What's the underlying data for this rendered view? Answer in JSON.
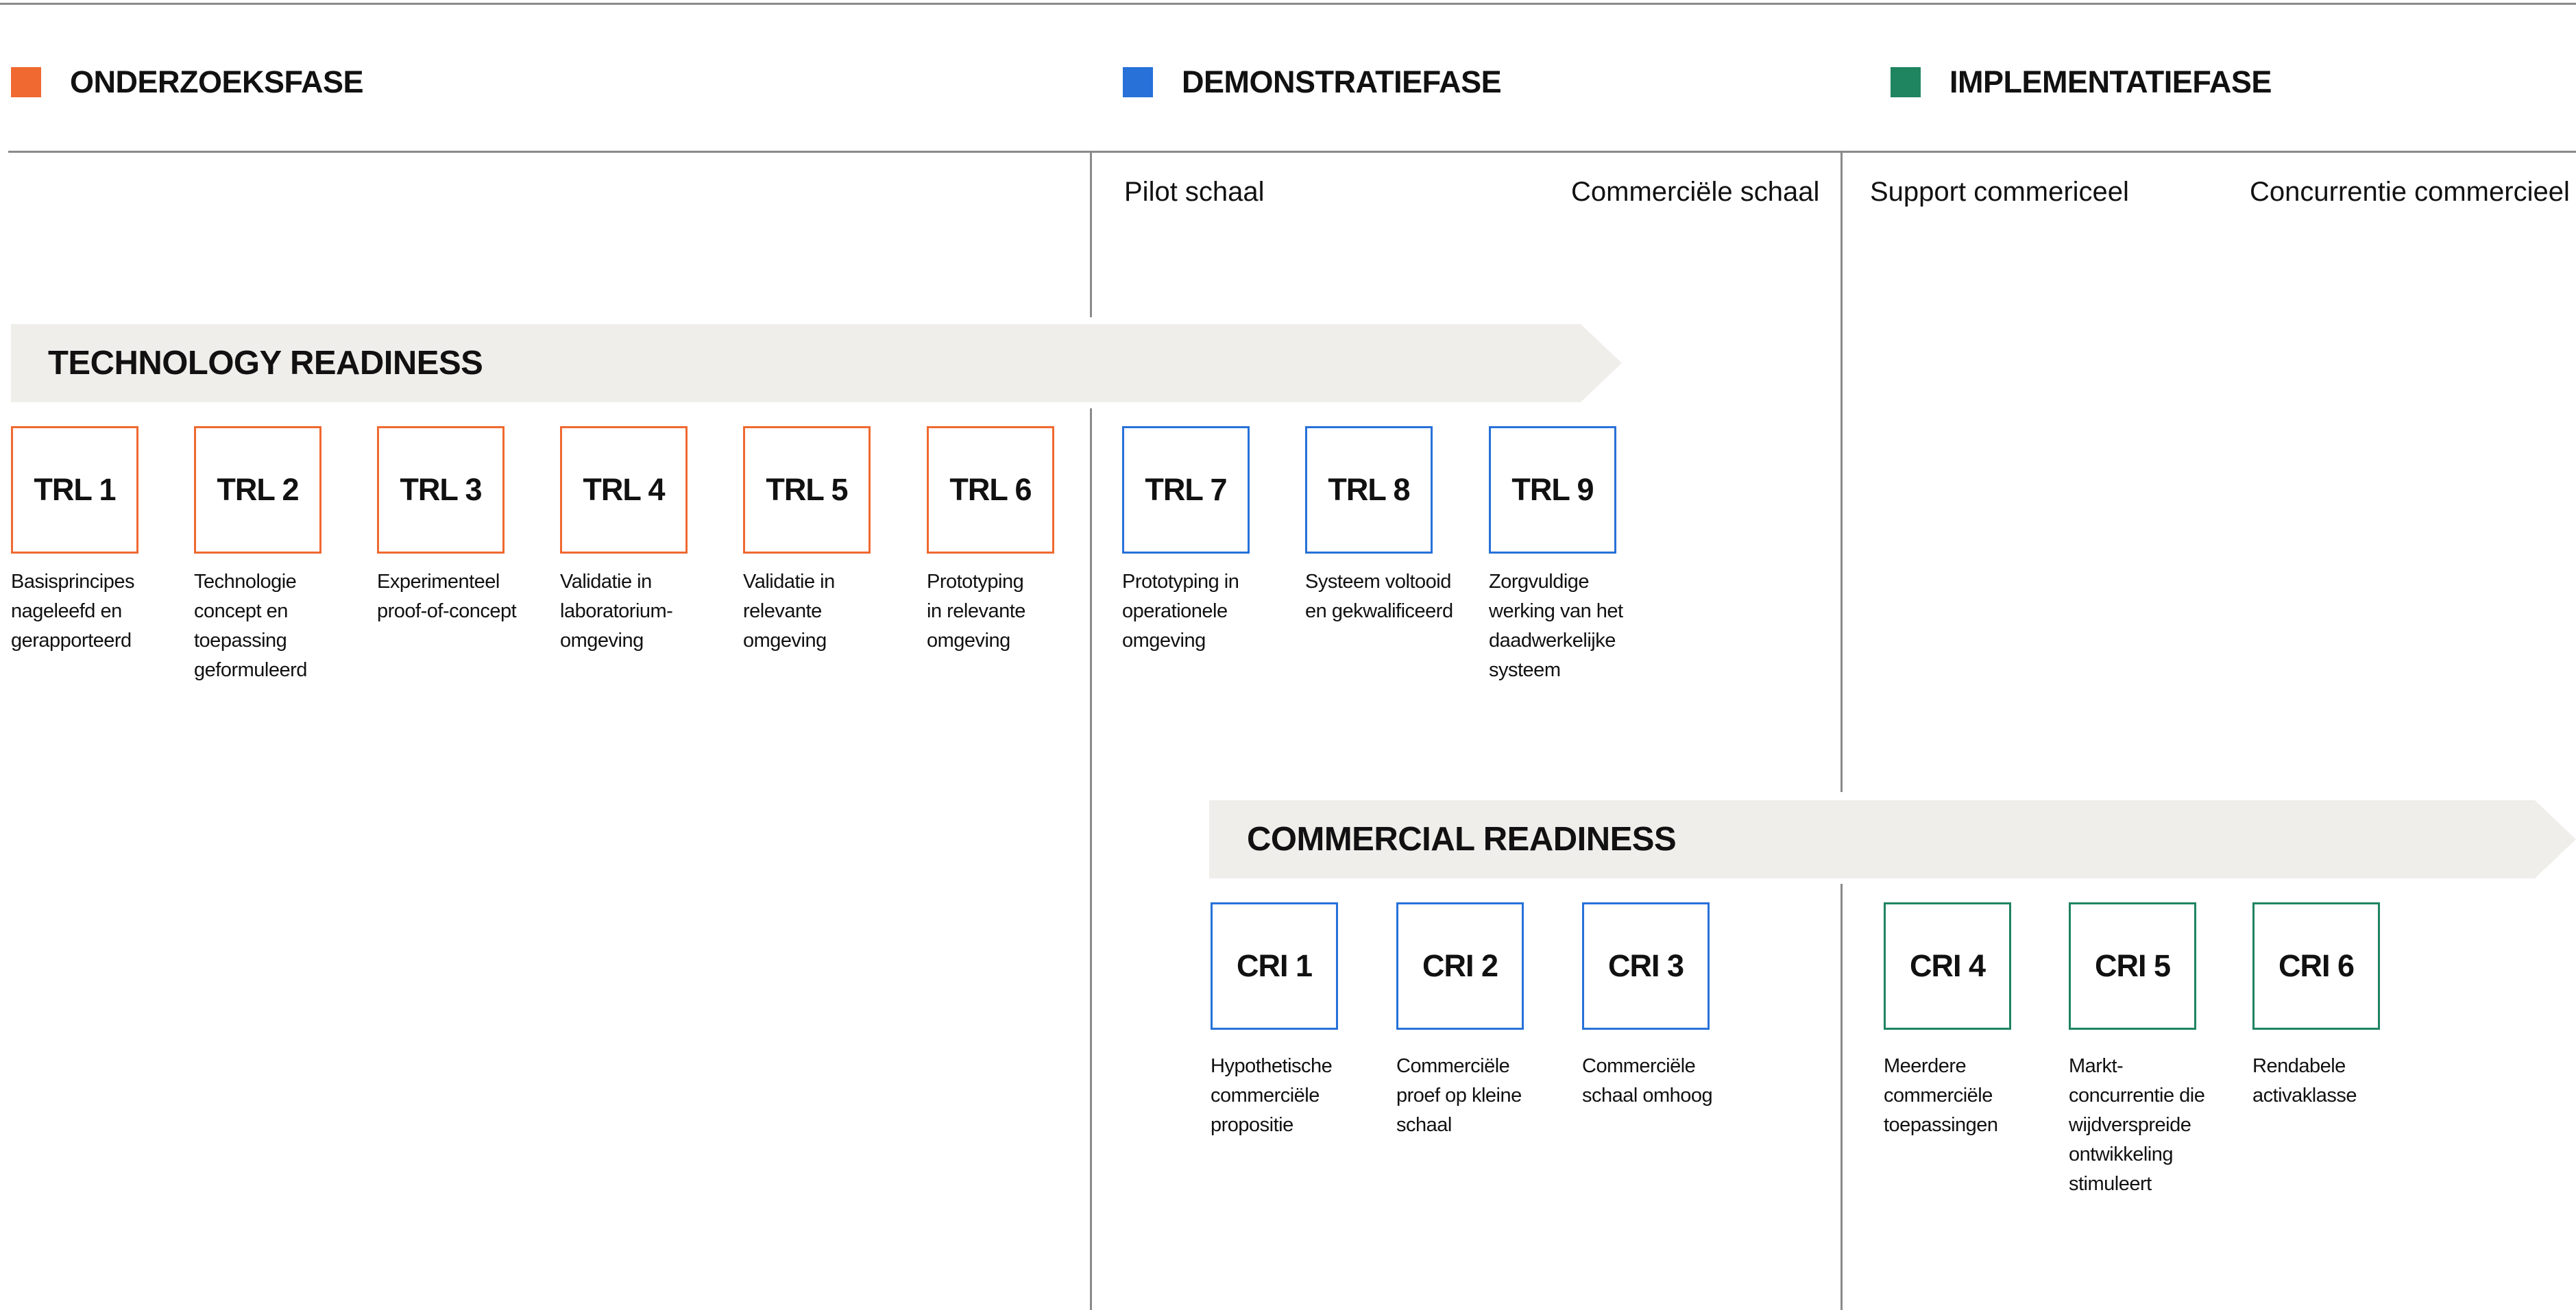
{
  "colors": {
    "onderzoek": "#ef6930",
    "demonstratie": "#2771d8",
    "implementatie": "#1f8460",
    "banner": "#f0eeeb",
    "line": "#8a8a8a"
  },
  "phases": [
    {
      "label": "ONDERZOEKSFASE"
    },
    {
      "label": "DEMONSTRATIEFASE"
    },
    {
      "label": "IMPLEMENTATIEFASE"
    }
  ],
  "scales": [
    {
      "label": "Pilot schaal"
    },
    {
      "label": "Commerciële schaal"
    },
    {
      "label": "Support commericeel"
    },
    {
      "label": "Concurrentie commercieel"
    }
  ],
  "technology": {
    "title": "TECHNOLOGY READINESS",
    "levels": [
      {
        "label": "TRL 1",
        "desc": "Basisprincipes nageleefd en gerapporteerd"
      },
      {
        "label": "TRL 2",
        "desc": "Technologie concept en toepassing geformuleerd"
      },
      {
        "label": "TRL 3",
        "desc": "Experimenteel proof-of-concept"
      },
      {
        "label": "TRL 4",
        "desc": "Validatie in laboratorium-omgeving"
      },
      {
        "label": "TRL 5",
        "desc": "Validatie in relevante omgeving"
      },
      {
        "label": "TRL 6",
        "desc": "Prototyping in relevante omgeving"
      },
      {
        "label": "TRL 7",
        "desc": "Prototyping in operationele omgeving"
      },
      {
        "label": "TRL 8",
        "desc": "Systeem voltooid en gekwalificeerd"
      },
      {
        "label": "TRL 9",
        "desc": "Zorgvuldige werking van het daadwerkelijke systeem"
      }
    ]
  },
  "commercial": {
    "title": "COMMERCIAL READINESS",
    "levels": [
      {
        "label": "CRI 1",
        "desc": "Hypothetische commerciële propositie"
      },
      {
        "label": "CRI 2",
        "desc": "Commerciële proef op kleine schaal"
      },
      {
        "label": "CRI 3",
        "desc": "Commerciële schaal omhoog"
      },
      {
        "label": "CRI 4",
        "desc": "Meerdere commerciële toepassingen"
      },
      {
        "label": "CRI 5",
        "desc": "Markt-concurrentie die wijdverspreide ontwikkeling stimuleert"
      },
      {
        "label": "CRI 6",
        "desc": "Rendabele activaklasse"
      }
    ]
  }
}
